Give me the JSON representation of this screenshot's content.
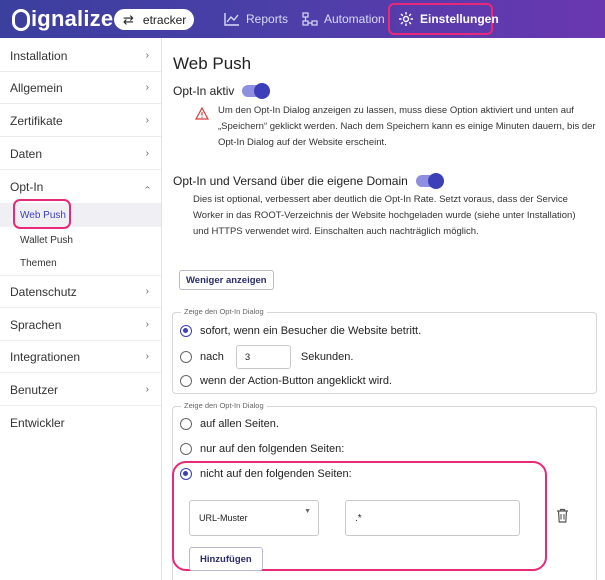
{
  "header": {
    "logo": "ignalize",
    "environment": "etracker",
    "nav": [
      {
        "label": "Reports",
        "icon": "chart-line-icon"
      },
      {
        "label": "Automation",
        "icon": "flow-icon"
      },
      {
        "label": "Einstellungen",
        "icon": "gear-icon"
      }
    ],
    "accent": "#e8297a"
  },
  "sidebar": {
    "items": [
      {
        "label": "Installation",
        "chevron": "›"
      },
      {
        "label": "Allgemein",
        "chevron": "›"
      },
      {
        "label": "Zertifikate",
        "chevron": "›"
      },
      {
        "label": "Daten",
        "chevron": "›"
      },
      {
        "label": "Opt-In",
        "chevron": "‹"
      }
    ],
    "subitems": [
      "Web Push",
      "Wallet Push",
      "Themen"
    ],
    "items_after": [
      {
        "label": "Datenschutz",
        "chevron": "›"
      },
      {
        "label": "Sprachen",
        "chevron": "›"
      },
      {
        "label": "Integrationen",
        "chevron": "›"
      },
      {
        "label": "Benutzer",
        "chevron": "›"
      },
      {
        "label": "Entwickler",
        "chevron": ""
      }
    ]
  },
  "main": {
    "title": "Web Push",
    "optin": {
      "label": "Opt-In aktiv",
      "warning_lines": [
        "Um den Opt-In Dialog anzeigen zu lassen, muss diese Option aktiviert und unten auf",
        "„Speichern“ geklickt werden. Nach dem Speichern kann es einige Minuten dauern, bis der",
        "Opt-In Dialog auf der Website erscheint."
      ]
    },
    "domain": {
      "label": "Opt-In und Versand über die eigene Domain",
      "desc_lines": [
        "Dies ist optional, verbessert aber deutlich die Opt-In Rate. Setzt voraus, dass der Service",
        "Worker in das ROOT-Verzeichnis der Website hochgeladen wurde (siehe unter Installation)",
        "und HTTPS verwendet wird. Einschalten auch nachträglich möglich."
      ]
    },
    "less_button": "Weniger anzeigen",
    "timing": {
      "legend": "Zeige den Opt-In Dialog",
      "opt1": "sofort, wenn ein Besucher die Website betritt.",
      "opt2_pre": "nach",
      "opt2_value": "3",
      "opt2_post": "Sekunden.",
      "opt3": "wenn der Action-Button angeklickt wird."
    },
    "pages": {
      "legend": "Zeige den Opt-In Dialog",
      "opt1": "auf allen Seiten.",
      "opt2": "nur auf den folgenden Seiten:",
      "opt3": "nicht auf den folgenden Seiten:",
      "select_value": "URL-Muster",
      "pattern_value": ".*",
      "add_button": "Hinzufügen"
    }
  }
}
